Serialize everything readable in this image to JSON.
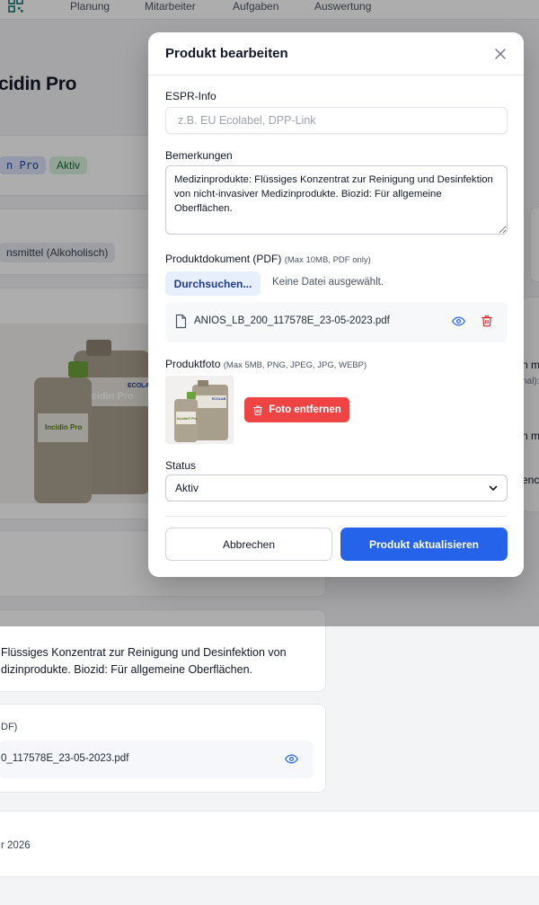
{
  "nav": {
    "items": [
      "Planung",
      "Mitarbeiter",
      "Aufgaben",
      "Auswertung"
    ]
  },
  "page": {
    "title_partial": "cidin Pro",
    "badge_code_partial": "n Pro",
    "badge_status": "Aktiv",
    "category_partial": "nsmittel (Alkoholisch)",
    "right_partial_1": "n m",
    "right_partial_2": "nal):",
    "right_partial_3": "n m",
    "right_partial_4": "enc",
    "remarks_line1_partial": "Flüssiges Konzentrat zur Reinigung und Desinfektion von",
    "remarks_line2_partial": "dizinprodukte. Biozid: Für allgemeine Oberflächen.",
    "doc_label_partial": "DF)",
    "doc_name_partial": "0_117578E_23-05-2023.pdf",
    "date_partial": "r 2026"
  },
  "modal": {
    "title": "Produkt bearbeiten",
    "espr": {
      "label": "ESPR-Info",
      "placeholder": "z.B. EU Ecolabel, DPP-Link",
      "value": ""
    },
    "remarks": {
      "label": "Bemerkungen",
      "value": "Medizinprodukte: Flüssiges Konzentrat zur Reinigung und Desinfektion von nicht-invasiver Medizinprodukte. Biozid: Für allgemeine Oberflächen."
    },
    "document": {
      "label": "Produktdokument (PDF)",
      "hint": "(Max 10MB, PDF only)",
      "browse_label": "Durchsuchen...",
      "no_file_text": "Keine Datei ausgewählt.",
      "file_name": "ANIOS_LB_200_117578E_23-05-2023.pdf"
    },
    "photo": {
      "label": "Produktfoto",
      "hint": "(Max 5MB, PNG, JPEG, JPG, WEBP)",
      "remove_label": "Foto entfernen",
      "product_brand": "ECOLAB",
      "product_name": "Incidin® Pro"
    },
    "status": {
      "label": "Status",
      "selected": "Aktiv"
    },
    "cancel_label": "Abbrechen",
    "submit_label": "Produkt aktualisieren"
  },
  "colors": {
    "primary": "#2563eb",
    "danger": "#ef4444",
    "danger_icon": "#dc2626",
    "eye_icon": "#2563eb",
    "badge_green": "#166534"
  }
}
